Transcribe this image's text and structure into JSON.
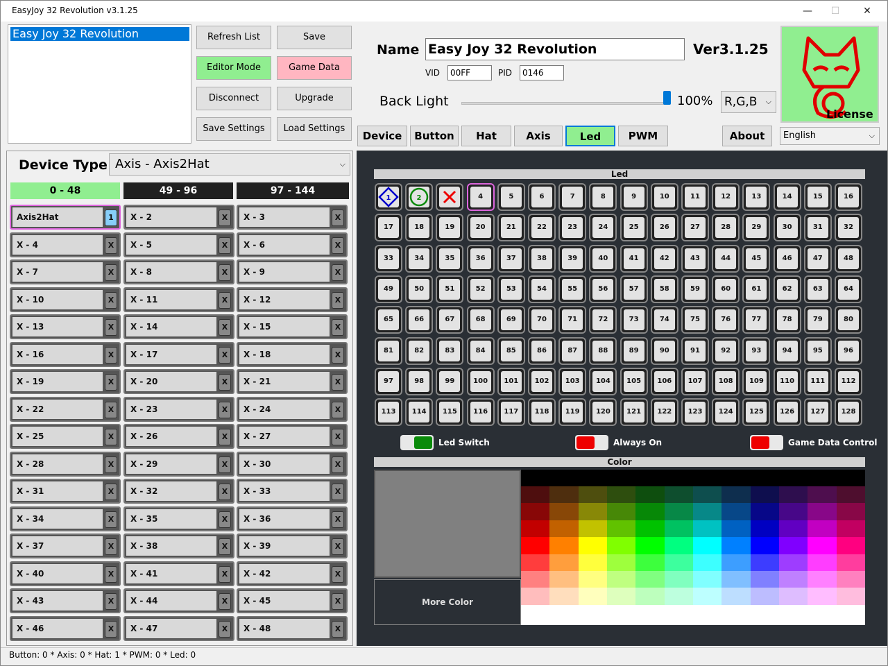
{
  "window": {
    "title": "EasyJoy 32 Revolution v3.1.25",
    "minimize": "—",
    "maximize": "☐",
    "close": "✕"
  },
  "device_list": [
    "Easy Joy 32 Revolution"
  ],
  "buttons": {
    "refresh": "Refresh List",
    "save": "Save",
    "editor": "Editor Mode",
    "game_data": "Game Data",
    "disconnect": "Disconnect",
    "upgrade": "Upgrade",
    "save_settings": "Save Settings",
    "load_settings": "Load Settings",
    "about": "About"
  },
  "info": {
    "name_label": "Name",
    "name_value": "Easy Joy 32 Revolution",
    "version": "Ver3.1.25",
    "vid_label": "VID",
    "vid": "00FF",
    "pid_label": "PID",
    "pid": "0146",
    "backlight_label": "Back Light",
    "backlight_value": "100%",
    "backlight_level": 1.0,
    "color_order": "R,G,B",
    "license": "License",
    "language": "English"
  },
  "tabs": [
    "Device",
    "Button",
    "Hat",
    "Axis",
    "Led",
    "PWM"
  ],
  "active_tab": "Led",
  "device_type": {
    "label": "Device Type",
    "value": "Axis - Axis2Hat"
  },
  "ranges": [
    "0 - 48",
    "49 - 96",
    "97 - 144"
  ],
  "slots": [
    "Axis2Hat",
    "X - 2",
    "X - 3",
    "X - 4",
    "X - 5",
    "X - 6",
    "X - 7",
    "X - 8",
    "X - 9",
    "X - 10",
    "X - 11",
    "X - 12",
    "X - 13",
    "X - 14",
    "X - 15",
    "X - 16",
    "X - 17",
    "X - 18",
    "X - 19",
    "X - 20",
    "X - 21",
    "X - 22",
    "X - 23",
    "X - 24",
    "X - 25",
    "X - 26",
    "X - 27",
    "X - 28",
    "X - 29",
    "X - 30",
    "X - 31",
    "X - 32",
    "X - 33",
    "X - 34",
    "X - 35",
    "X - 36",
    "X - 37",
    "X - 38",
    "X - 39",
    "X - 40",
    "X - 41",
    "X - 42",
    "X - 43",
    "X - 44",
    "X - 45",
    "X - 46",
    "X - 47",
    "X - 48"
  ],
  "slot_badge": "1",
  "slot_x": "X",
  "led_panel": {
    "title": "Led",
    "count": 128,
    "first_labels": [
      "1",
      "2",
      "✕"
    ]
  },
  "switches": {
    "led_switch": "Led Switch",
    "always_on": "Always On",
    "game_data_control": "Game Data Control"
  },
  "color_panel": {
    "title": "Color",
    "more": "More Color"
  },
  "status": "Button:  0    *  Axis:  0    *  Hat:  1    *  PWM:  0    *  Led:  0",
  "colors": {
    "accent_green": "#90ee90",
    "accent_pink": "#ffb6c1",
    "selected_blue": "#0078d7",
    "led_border": "#dd66dd"
  }
}
